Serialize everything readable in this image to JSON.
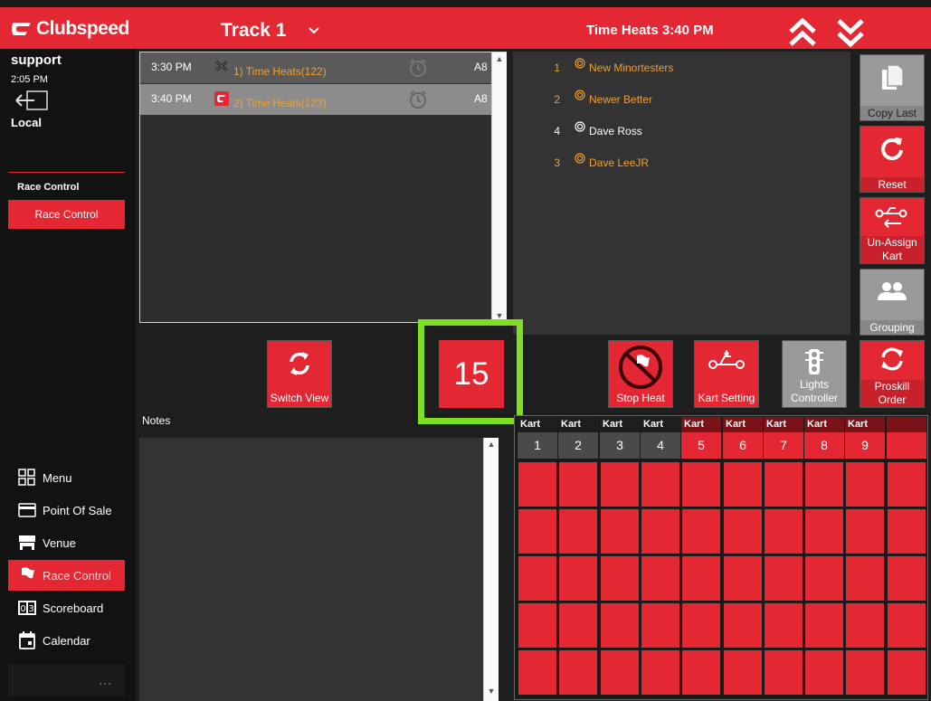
{
  "header": {
    "brand": "Clubspeed",
    "track": "Track 1",
    "heat_title": "Time Heats 3:40 PM"
  },
  "user": {
    "name": "support",
    "time": "2:05 PM",
    "location": "Local"
  },
  "sidebar": {
    "section_title": "Race Control",
    "section_button": "Race Control",
    "nav": [
      {
        "label": "Menu",
        "icon": "grid-icon"
      },
      {
        "label": "Point Of Sale",
        "icon": "card-icon"
      },
      {
        "label": "Venue",
        "icon": "store-icon"
      },
      {
        "label": "Race Control",
        "icon": "flag-icon",
        "active": true
      },
      {
        "label": "Scoreboard",
        "icon": "scoreboard-icon"
      },
      {
        "label": "Calendar",
        "icon": "calendar-icon"
      }
    ],
    "more": "..."
  },
  "heats": [
    {
      "time": "3:30 PM",
      "name": "1) Time Heats(122)",
      "code": "A8",
      "status": "finished"
    },
    {
      "time": "3:40 PM",
      "name": "2) Time Heats(123)",
      "code": "A8",
      "status": "current"
    }
  ],
  "racers": [
    {
      "pos": "1",
      "name": "New Minortesters",
      "color": "#f0a030"
    },
    {
      "pos": "2",
      "name": "Newer Better",
      "color": "#f0a030"
    },
    {
      "pos": "4",
      "name": "Dave Ross",
      "color": "#ffffff"
    },
    {
      "pos": "3",
      "name": "Dave LeeJR",
      "color": "#f0a030"
    }
  ],
  "actions": {
    "copy_last": "Copy Last",
    "reset": "Reset",
    "unassign_kart": "Un-Assign Kart",
    "grouping": "Grouping",
    "proskill_order": "Proskill Order",
    "lights_controller": "Lights Controller",
    "kart_setting": "Kart Setting",
    "stop_heat": "Stop Heat",
    "switch_view": "Switch View"
  },
  "counter": "15",
  "notes_label": "Notes",
  "karts": {
    "header_label": "Kart",
    "numbers": [
      "1",
      "2",
      "3",
      "4",
      "5",
      "6",
      "7",
      "8",
      "9"
    ]
  },
  "colors": {
    "accent": "#e32733",
    "highlight": "#7ddf1f",
    "racer_orange": "#f0a030"
  }
}
